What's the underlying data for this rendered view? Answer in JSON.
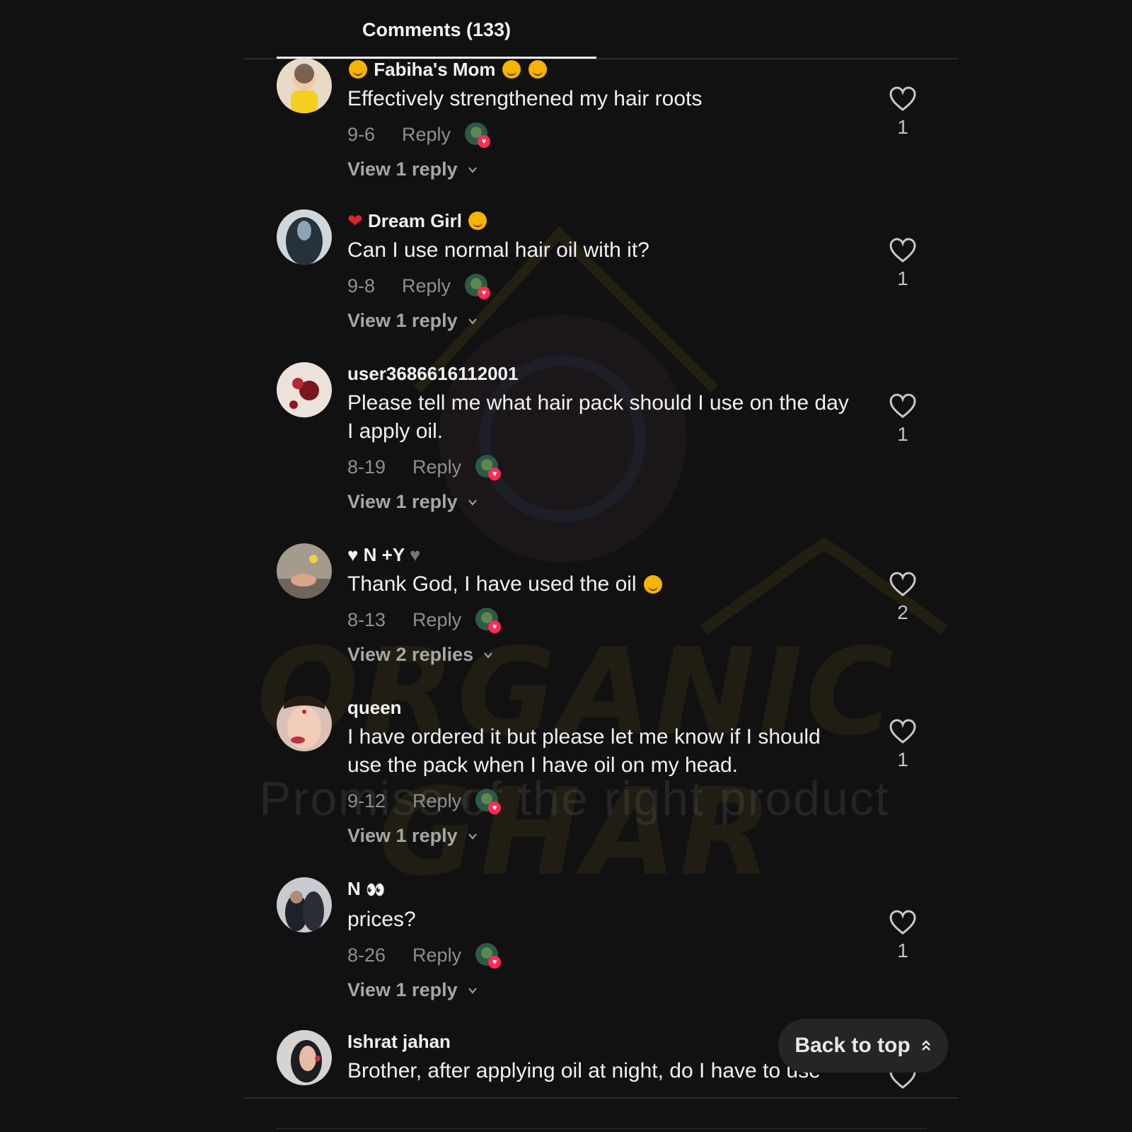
{
  "header": {
    "tab_label": "Comments (133)"
  },
  "watermark": {
    "brand": "ORGANIC GHAR",
    "tagline": "Promise of the right product"
  },
  "comments": [
    {
      "username": "Fabiha's Mom",
      "text": "Effectively strengthened my hair roots",
      "date": "9-6",
      "reply_label": "Reply",
      "view_replies": "View 1 reply",
      "likes": "1"
    },
    {
      "username": "Dream Girl",
      "text": "Can I use normal hair oil with it?",
      "date": "9-8",
      "reply_label": "Reply",
      "view_replies": "View 1 reply",
      "likes": "1"
    },
    {
      "username": "user3686616112001",
      "text": "Please tell me what hair pack should I use on the day I apply oil.",
      "date": "8-19",
      "reply_label": "Reply",
      "view_replies": "View 1 reply",
      "likes": "1"
    },
    {
      "username": "N +Y",
      "text": "Thank God, I have used the oil",
      "date": "8-13",
      "reply_label": "Reply",
      "view_replies": "View 2 replies",
      "likes": "2"
    },
    {
      "username": "queen",
      "text": "I have ordered it but please let me know if I should use the pack when I have oil on my head.",
      "date": "9-12",
      "reply_label": "Reply",
      "view_replies": "View 1 reply",
      "likes": "1"
    },
    {
      "username": "N",
      "text": "prices?",
      "date": "8-26",
      "reply_label": "Reply",
      "view_replies": "View 1 reply",
      "likes": "1"
    },
    {
      "username": "Ishrat jahan",
      "text": "Brother, after applying oil at night, do I have to use",
      "date": "",
      "reply_label": "",
      "view_replies": "",
      "likes": ""
    }
  ],
  "back_to_top": {
    "label": "Back to top"
  },
  "colors": {
    "background": "#111112",
    "accent_like": "#fe2c55",
    "muted_text": "#8f8f8f"
  }
}
